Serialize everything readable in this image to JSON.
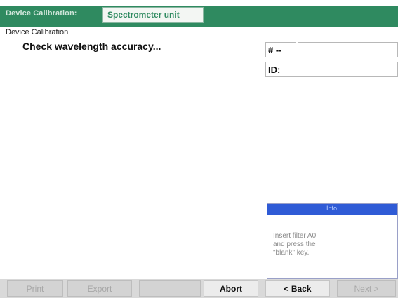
{
  "header": {
    "title_left": "Device Calibration:",
    "active_tab": "Spectrometer unit"
  },
  "subtitle": "Device Calibration",
  "prompt": "Check wavelength accuracy...",
  "fields": {
    "number_label": "# --",
    "id_label": "ID:"
  },
  "message": {
    "title": "Info",
    "line1": "Insert filter A0",
    "line2": "and press the",
    "line3": "\"blank\" key."
  },
  "buttons": {
    "print": "Print",
    "export": "Export",
    "blank": "",
    "abort": "Abort",
    "back": "< Back",
    "next": "Next >"
  }
}
